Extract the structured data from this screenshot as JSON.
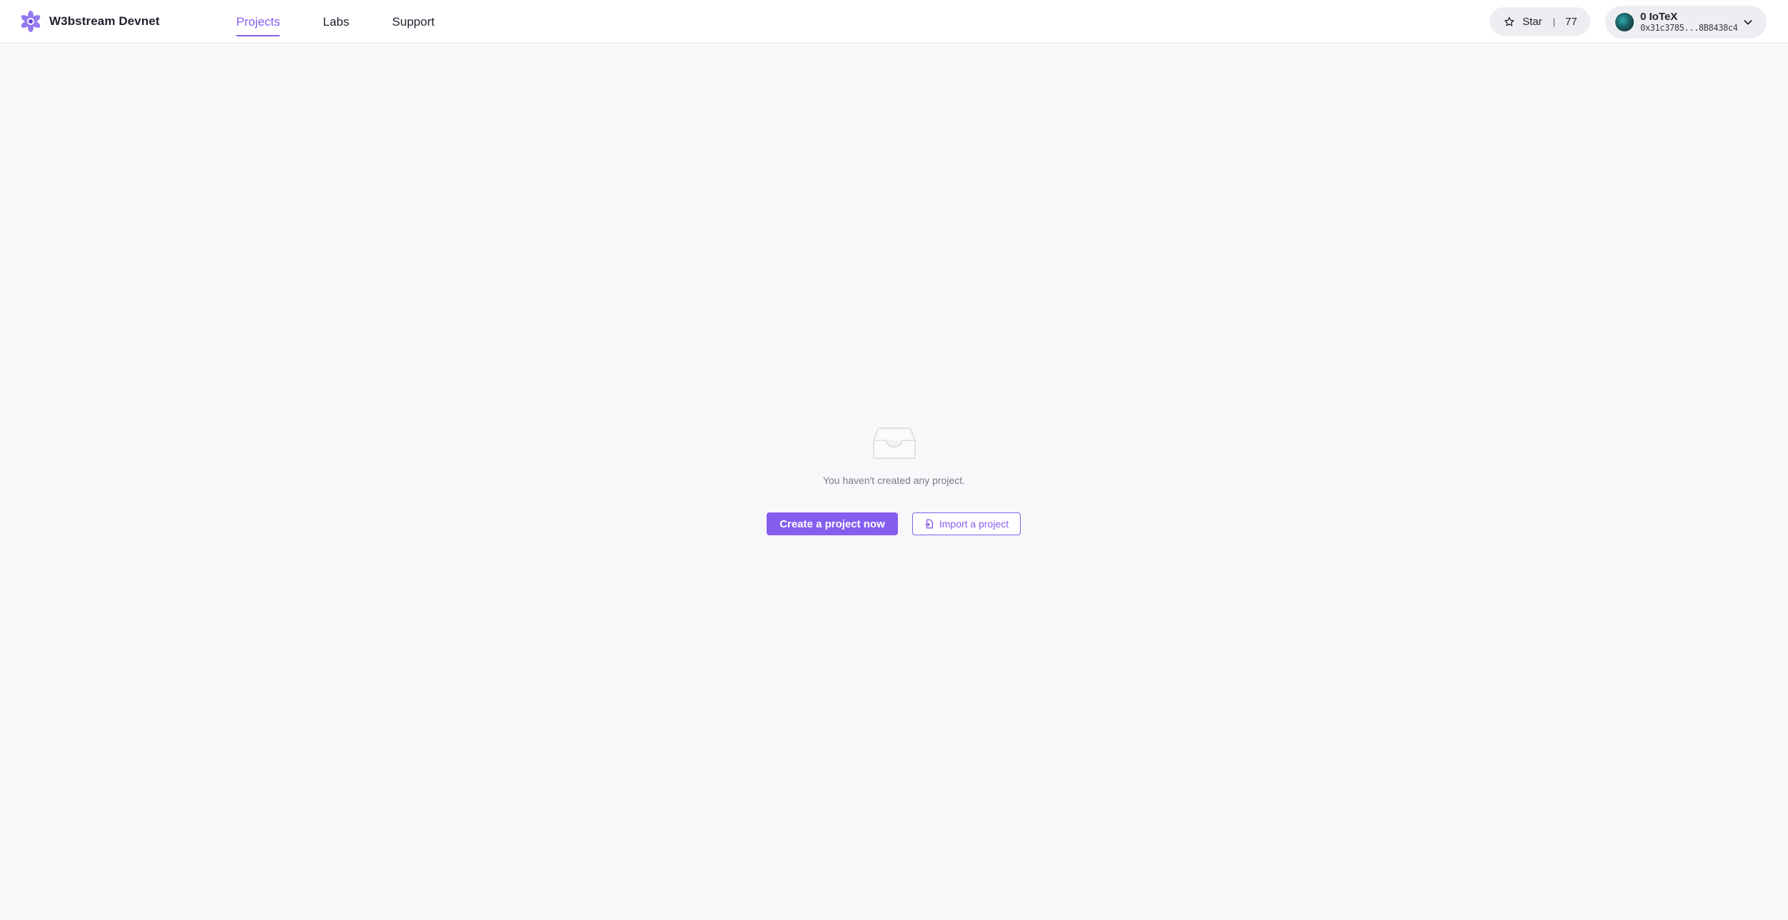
{
  "app": {
    "name": "W3bstream Devnet",
    "accent_color": "#855eef",
    "logo_icon": "w3bstream-logo-icon"
  },
  "nav": {
    "items": [
      {
        "label": "Projects",
        "active": true
      },
      {
        "label": "Labs",
        "active": false
      },
      {
        "label": "Support",
        "active": false
      }
    ]
  },
  "github_star": {
    "icon": "star-icon",
    "label": "Star",
    "separator": "|",
    "count": "77"
  },
  "account": {
    "balance": "0 IoTeX",
    "address": "0x31c3785...8B8438c4",
    "dropdown_icon": "chevron-down-icon"
  },
  "empty_state": {
    "icon": "empty-inbox-icon",
    "message": "You haven't created any project.",
    "create_label": "Create a project now",
    "import_label": "Import a project",
    "import_icon": "import-file-icon"
  }
}
